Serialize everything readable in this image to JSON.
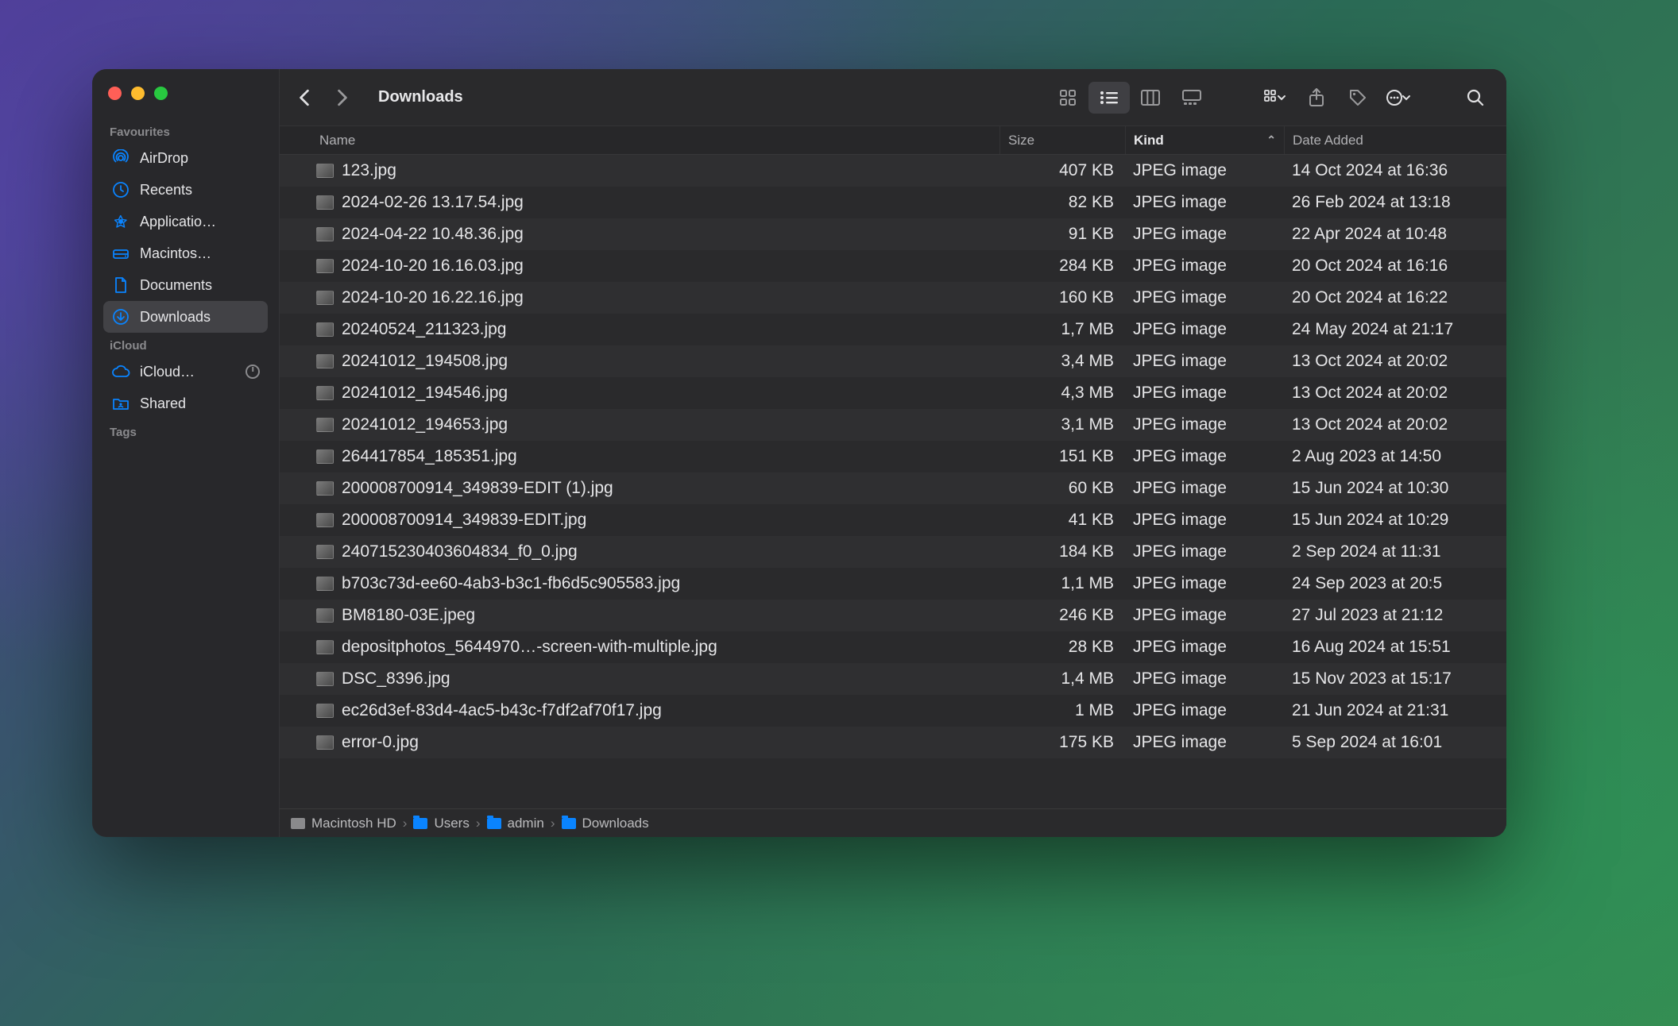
{
  "title": "Downloads",
  "sidebar": {
    "sections": [
      {
        "label": "Favourites",
        "items": [
          {
            "label": "AirDrop",
            "icon": "airdrop"
          },
          {
            "label": "Recents",
            "icon": "clock"
          },
          {
            "label": "Applicatio…",
            "icon": "apps"
          },
          {
            "label": "Macintos…",
            "icon": "disk"
          },
          {
            "label": "Documents",
            "icon": "document"
          },
          {
            "label": "Downloads",
            "icon": "download",
            "selected": true
          }
        ]
      },
      {
        "label": "iCloud",
        "items": [
          {
            "label": "iCloud…",
            "icon": "cloud",
            "trailing": true
          },
          {
            "label": "Shared",
            "icon": "shared-folder"
          }
        ]
      },
      {
        "label": "Tags",
        "items": []
      }
    ]
  },
  "columns": {
    "name": "Name",
    "size": "Size",
    "kind": "Kind",
    "date": "Date Added",
    "sorted": "kind"
  },
  "files": [
    {
      "name": "123.jpg",
      "size": "407 KB",
      "kind": "JPEG image",
      "date": "14 Oct 2024 at 16:36"
    },
    {
      "name": "2024-02-26 13.17.54.jpg",
      "size": "82 KB",
      "kind": "JPEG image",
      "date": "26 Feb 2024 at 13:18"
    },
    {
      "name": "2024-04-22 10.48.36.jpg",
      "size": "91 KB",
      "kind": "JPEG image",
      "date": "22 Apr 2024 at 10:48"
    },
    {
      "name": "2024-10-20 16.16.03.jpg",
      "size": "284 KB",
      "kind": "JPEG image",
      "date": "20 Oct 2024 at 16:16"
    },
    {
      "name": "2024-10-20 16.22.16.jpg",
      "size": "160 KB",
      "kind": "JPEG image",
      "date": "20 Oct 2024 at 16:22"
    },
    {
      "name": "20240524_211323.jpg",
      "size": "1,7 MB",
      "kind": "JPEG image",
      "date": "24 May 2024 at 21:17"
    },
    {
      "name": "20241012_194508.jpg",
      "size": "3,4 MB",
      "kind": "JPEG image",
      "date": "13 Oct 2024 at 20:02"
    },
    {
      "name": "20241012_194546.jpg",
      "size": "4,3 MB",
      "kind": "JPEG image",
      "date": "13 Oct 2024 at 20:02"
    },
    {
      "name": "20241012_194653.jpg",
      "size": "3,1 MB",
      "kind": "JPEG image",
      "date": "13 Oct 2024 at 20:02"
    },
    {
      "name": "264417854_185351.jpg",
      "size": "151 KB",
      "kind": "JPEG image",
      "date": "2 Aug 2023 at 14:50"
    },
    {
      "name": "200008700914_349839-EDIT (1).jpg",
      "size": "60 KB",
      "kind": "JPEG image",
      "date": "15 Jun 2024 at 10:30"
    },
    {
      "name": "200008700914_349839-EDIT.jpg",
      "size": "41 KB",
      "kind": "JPEG image",
      "date": "15 Jun 2024 at 10:29"
    },
    {
      "name": "240715230403604834_f0_0.jpg",
      "size": "184 KB",
      "kind": "JPEG image",
      "date": "2 Sep 2024 at 11:31"
    },
    {
      "name": "b703c73d-ee60-4ab3-b3c1-fb6d5c905583.jpg",
      "size": "1,1 MB",
      "kind": "JPEG image",
      "date": "24 Sep 2023 at 20:5"
    },
    {
      "name": "BM8180-03E.jpeg",
      "size": "246 KB",
      "kind": "JPEG image",
      "date": "27 Jul 2023 at 21:12"
    },
    {
      "name": "depositphotos_5644970…-screen-with-multiple.jpg",
      "size": "28 KB",
      "kind": "JPEG image",
      "date": "16 Aug 2024 at 15:51"
    },
    {
      "name": "DSC_8396.jpg",
      "size": "1,4 MB",
      "kind": "JPEG image",
      "date": "15 Nov 2023 at 15:17"
    },
    {
      "name": "ec26d3ef-83d4-4ac5-b43c-f7df2af70f17.jpg",
      "size": "1 MB",
      "kind": "JPEG image",
      "date": "21 Jun 2024 at 21:31"
    },
    {
      "name": "error-0.jpg",
      "size": "175 KB",
      "kind": "JPEG image",
      "date": "5 Sep 2024 at 16:01"
    }
  ],
  "pathbar": [
    {
      "label": "Macintosh HD",
      "icon": "disk"
    },
    {
      "label": "Users",
      "icon": "folder"
    },
    {
      "label": "admin",
      "icon": "folder"
    },
    {
      "label": "Downloads",
      "icon": "folder"
    }
  ]
}
